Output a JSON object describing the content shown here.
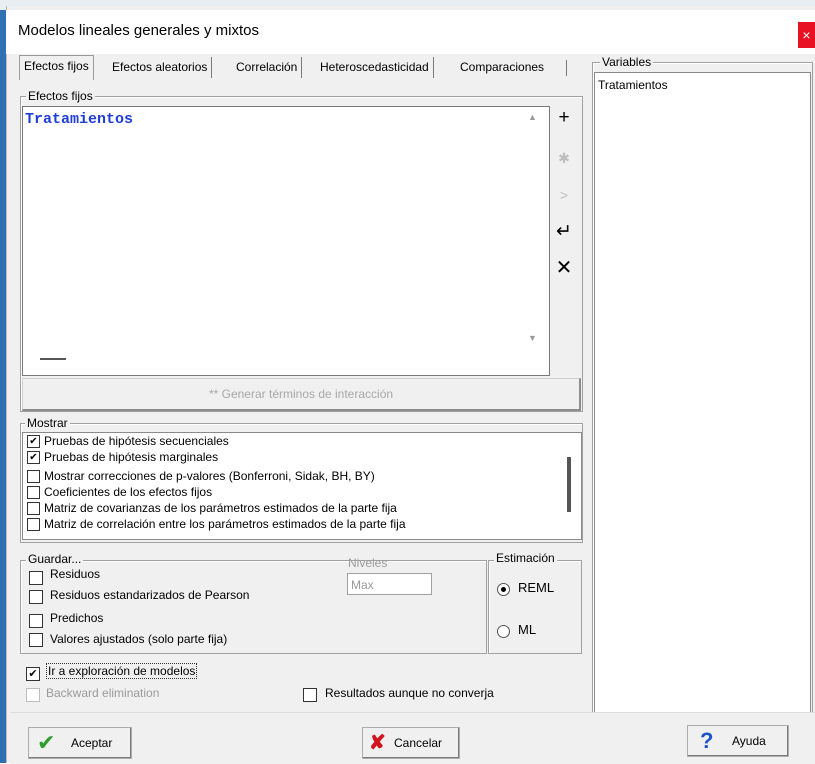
{
  "window": {
    "title": "Modelos lineales generales y mixtos",
    "close_glyph": "×"
  },
  "tabs": [
    {
      "label": "Efectos fijos",
      "active": true
    },
    {
      "label": "Efectos aleatorios",
      "active": false
    },
    {
      "label": "Correlación",
      "active": false
    },
    {
      "label": "Heteroscedasticidad",
      "active": false
    },
    {
      "label": "Comparaciones",
      "active": false
    }
  ],
  "fixed_effects": {
    "group_label": "Efectos fijos",
    "text": "Tratamientos",
    "side_buttons": [
      {
        "name": "add-icon",
        "glyph": "+",
        "enabled": true
      },
      {
        "name": "asterisk-icon",
        "glyph": "✱",
        "enabled": false
      },
      {
        "name": "arrow-right-icon",
        "glyph": ">",
        "enabled": false
      },
      {
        "name": "enter-icon",
        "glyph": "↵",
        "enabled": true
      },
      {
        "name": "delete-icon",
        "glyph": "✕",
        "enabled": true
      }
    ],
    "interaction_button": "** Generar términos de interacción"
  },
  "mostrar": {
    "group_label": "Mostrar",
    "items": [
      {
        "label": "Pruebas de hipótesis secuenciales",
        "checked": true
      },
      {
        "label": "Pruebas de hipótesis marginales",
        "checked": true
      },
      {
        "label": "Mostrar correcciones de p-valores (Bonferroni, Sidak, BH, BY)",
        "checked": false
      },
      {
        "label": "Coeficientes de los efectos fijos",
        "checked": false
      },
      {
        "label": "Matriz de covarianzas de los parámetros estimados de la parte fija",
        "checked": false
      },
      {
        "label": "Matriz de correlación entre los parámetros estimados de la parte fija",
        "checked": false
      }
    ]
  },
  "guardar": {
    "group_label": "Guardar...",
    "items": [
      {
        "label": "Residuos",
        "checked": false
      },
      {
        "label": "Residuos estandarizados de Pearson",
        "checked": false
      },
      {
        "label": "Predichos",
        "checked": false
      },
      {
        "label": "Valores ajustados (solo parte fija)",
        "checked": false
      }
    ],
    "niveles_label": "Niveles",
    "niveles_value": "Max"
  },
  "estimacion": {
    "group_label": "Estimación",
    "options": [
      {
        "label": "REML",
        "selected": true
      },
      {
        "label": "ML",
        "selected": false
      }
    ]
  },
  "options": {
    "explore_models": {
      "label": "Ir a exploración de modelos",
      "checked": true
    },
    "backward": {
      "label": "Backward elimination",
      "checked": false,
      "enabled": false
    },
    "no_converge": {
      "label": "Resultados aunque no converja",
      "checked": false
    }
  },
  "variables": {
    "group_label": "Variables",
    "items": [
      "Tratamientos"
    ]
  },
  "buttons": {
    "accept": "Aceptar",
    "cancel": "Cancelar",
    "help": "Ayuda"
  },
  "colors": {
    "effect_text": "#1f3ed8",
    "accept_icon": "#2e9e2e",
    "cancel_icon": "#d4141c",
    "help_icon": "#1c54c8",
    "close_button": "#e81123"
  }
}
